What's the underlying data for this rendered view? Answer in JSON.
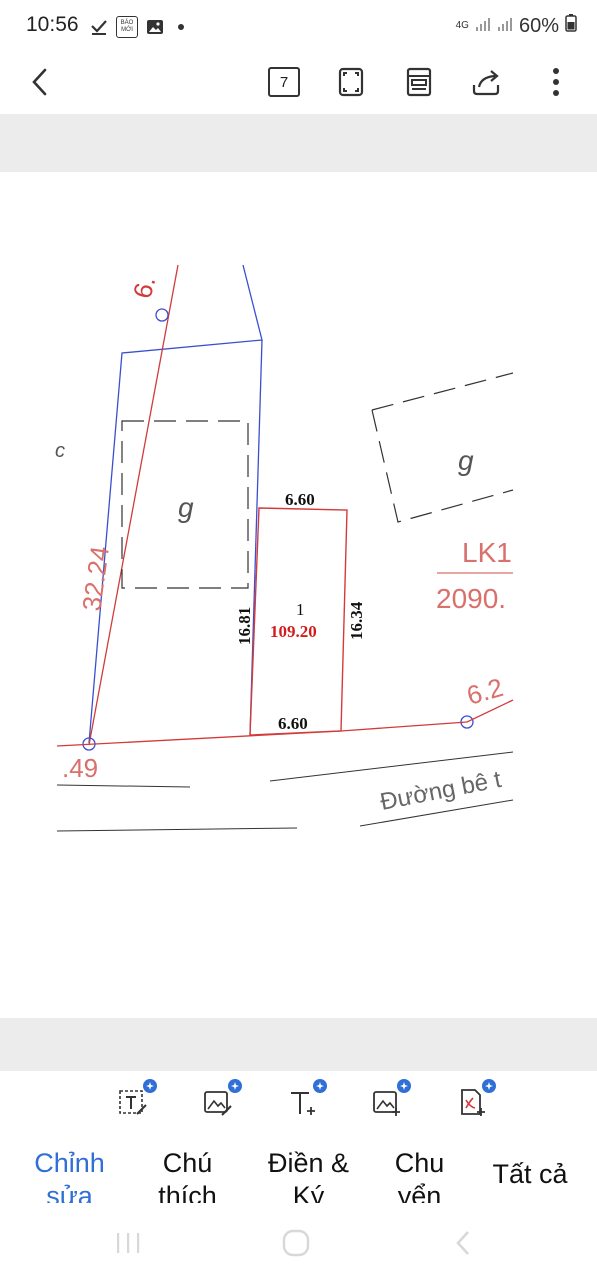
{
  "status_bar": {
    "time": "10:56",
    "network": "4G",
    "battery": "60%",
    "news_icon_text": "BÁO MỚI"
  },
  "toolbar": {
    "page_count": "7",
    "icons": [
      "back-arrow-icon",
      "page-count-icon",
      "fullscreen-icon",
      "reading-mode-icon",
      "share-icon",
      "more-options-icon"
    ]
  },
  "drawing": {
    "left_label": "c",
    "g_left": "g",
    "g_right": "g",
    "label_lk": "LK1",
    "label_area_big": "2090.",
    "top_dim": "6.60",
    "bottom_dim": "6.60",
    "left_dim": "16.81",
    "right_dim": "16.34",
    "parcel_number": "1",
    "parcel_area": "109.20",
    "diag_dim": "32.24",
    "top_partial": "6.",
    "right_partial": "6.2",
    "corner_label": ".49",
    "road_label": "Đường bê t",
    "colors": {
      "red": "#d23b3b",
      "blue": "#3a4fd0",
      "black": "#111111"
    }
  },
  "bottom_tools": {
    "icons": [
      "text-edit-icon",
      "image-edit-icon",
      "add-text-icon",
      "add-image-icon",
      "add-pdf-icon"
    ],
    "accent": "#2f6fd6"
  },
  "tabs": [
    {
      "line1": "Chỉnh",
      "line2": "sửa",
      "active": true
    },
    {
      "line1": "Chú",
      "line2": "thích",
      "active": false
    },
    {
      "line1": "Điền &",
      "line2": "Ký",
      "active": false
    },
    {
      "line1": "Chu",
      "line2": "yển",
      "active": false
    },
    {
      "line1": "Tất cả",
      "line2": "",
      "active": false
    }
  ]
}
